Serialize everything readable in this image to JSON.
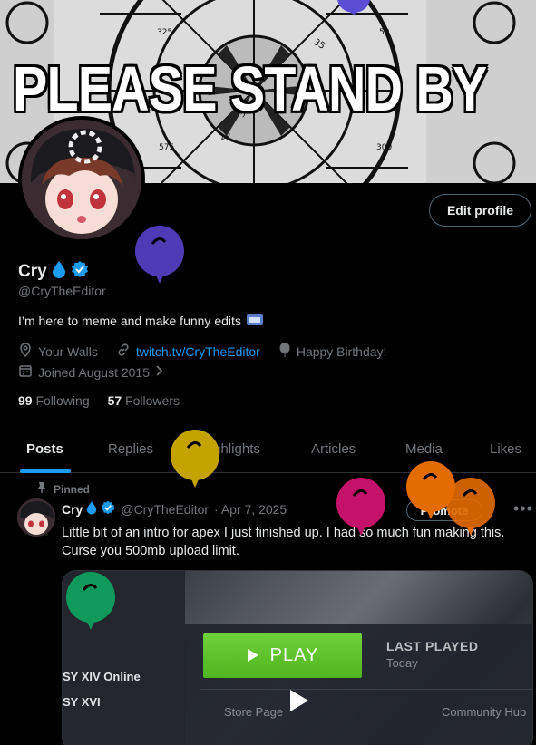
{
  "banner": {
    "text": "PLEASE STAND BY",
    "marks": [
      "325",
      "35",
      "30",
      "20",
      "575",
      "50",
      "300"
    ]
  },
  "profile": {
    "edit_label": "Edit profile",
    "name": "Cry",
    "handle": "@CryTheEditor",
    "bio": "I’m here to meme and make funny edits",
    "location": "Your Walls",
    "link": "twitch.tv/CryTheEditor",
    "birthday": "Happy Birthday!",
    "joined": "Joined August 2015",
    "following_count": "99",
    "following_label": "Following",
    "followers_count": "57",
    "followers_label": "Followers"
  },
  "tabs": [
    {
      "label": "Posts"
    },
    {
      "label": "Replies"
    },
    {
      "label": "Highlights"
    },
    {
      "label": "Articles"
    },
    {
      "label": "Media"
    },
    {
      "label": "Likes"
    }
  ],
  "post": {
    "pinned_label": "Pinned",
    "name": "Cry",
    "handle": "@CryTheEditor",
    "date": "· Apr 7, 2025",
    "promote_label": "Promote",
    "more": "•••",
    "text": "Little bit of an intro for apex I just finished up. I had so much fun making this. Curse you 500mb upload limit.",
    "media": {
      "play_label": "PLAY",
      "last_played": "LAST PLAYED",
      "today": "Today",
      "game1": "SY XIV Online",
      "game2": "SY XVI",
      "store": "Store Page",
      "community": "Community Hub"
    }
  },
  "colors": {
    "accent": "#1d9bf0",
    "play_green": "#5cc22a",
    "balloon_purple": "#4f3bb5",
    "balloon_gold": "#c4a200",
    "balloon_magenta": "#c4126a",
    "balloon_orange": "#e36b00",
    "balloon_green": "#0f9a5c"
  }
}
